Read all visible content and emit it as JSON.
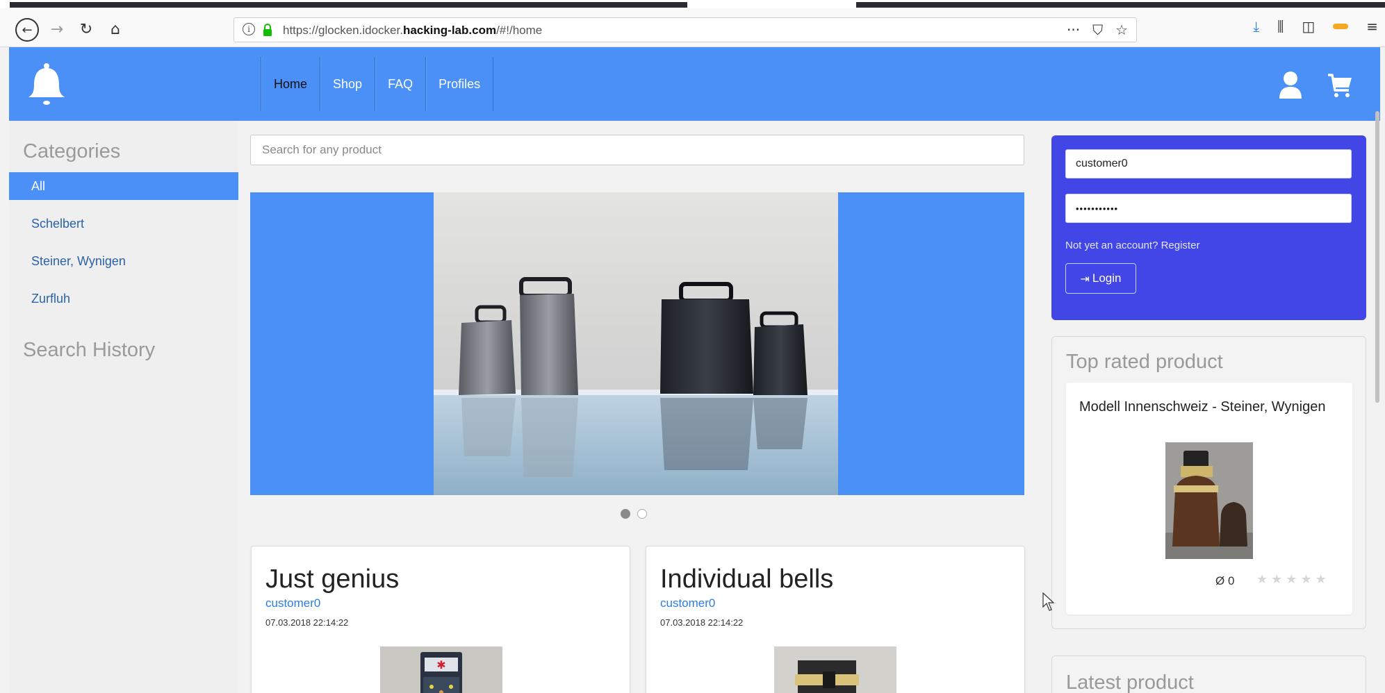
{
  "browser": {
    "url_prefix": "https://glocken.idocker.",
    "url_domain": "hacking-lab.com",
    "url_suffix": "/#!/home",
    "back_icon": "arrow-left-icon",
    "forward_icon": "arrow-right-icon",
    "reload_icon": "reload-icon",
    "home_icon": "home-icon",
    "menu_dots": "···",
    "menu_lines": "≡"
  },
  "header": {
    "accent_color": "#4a90f7",
    "nav": [
      {
        "label": "Home",
        "active": true
      },
      {
        "label": "Shop"
      },
      {
        "label": "FAQ"
      },
      {
        "label": "Profiles"
      }
    ]
  },
  "sidebar": {
    "categories_title": "Categories",
    "categories": [
      {
        "label": "All",
        "active": true
      },
      {
        "label": "Schelbert"
      },
      {
        "label": "Steiner, Wynigen"
      },
      {
        "label": "Zurfluh"
      }
    ],
    "search_history_title": "Search History"
  },
  "search": {
    "placeholder": "Search for any product"
  },
  "carousel": {
    "slides": 2,
    "active_slide": 1
  },
  "posts": [
    {
      "title": "Just genius",
      "author": "customer0",
      "date": "07.03.2018 22:14:22"
    },
    {
      "title": "Individual bells",
      "author": "customer0",
      "date": "07.03.2018 22:14:22"
    }
  ],
  "login": {
    "panel_color": "#4346e6",
    "username": "customer0",
    "password": "•••••••••••",
    "register_link": "Not yet an account? Register",
    "login_button": "Login",
    "login_icon": "sign-in-icon"
  },
  "top_rated": {
    "title": "Top rated product",
    "product_name": "Modell Innenschweiz - Steiner, Wynigen",
    "rating_avg": "Ø 0",
    "stars_filled": 0,
    "stars_total": 5
  },
  "latest": {
    "title": "Latest product"
  }
}
